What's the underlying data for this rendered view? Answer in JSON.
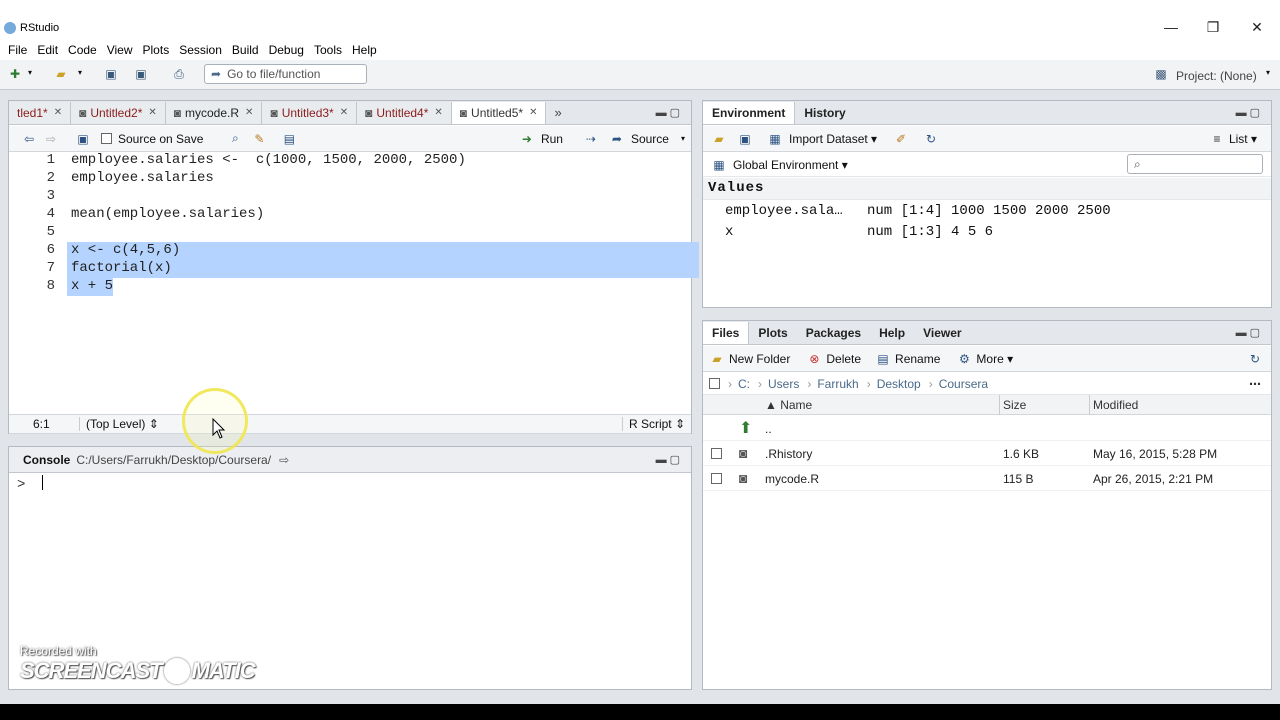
{
  "window": {
    "title": "RStudio",
    "controls": [
      "—",
      "❐",
      "✕"
    ]
  },
  "menu": [
    "File",
    "Edit",
    "Code",
    "View",
    "Plots",
    "Session",
    "Build",
    "Debug",
    "Tools",
    "Help"
  ],
  "toolbar": {
    "goto_placeholder": "Go to file/function",
    "project_label": "Project: (None)"
  },
  "source": {
    "tabs": [
      {
        "label": "tled1*",
        "active": false
      },
      {
        "label": "Untitled2*",
        "active": false
      },
      {
        "label": "mycode.R",
        "active": false
      },
      {
        "label": "Untitled3*",
        "active": false
      },
      {
        "label": "Untitled4*",
        "active": false
      },
      {
        "label": "Untitled5*",
        "active": true
      }
    ],
    "source_on_save": "Source on Save",
    "run_label": "Run",
    "source_label": "Source",
    "lines": [
      {
        "n": "1",
        "code": "employee.salaries <-  c(1000, 1500, 2000, 2500)",
        "selected": false
      },
      {
        "n": "2",
        "code": "employee.salaries",
        "selected": false
      },
      {
        "n": "3",
        "code": "",
        "selected": false
      },
      {
        "n": "4",
        "code": "mean(employee.salaries)",
        "selected": false
      },
      {
        "n": "5",
        "code": "",
        "selected": false
      },
      {
        "n": "6",
        "code": "x <- c(4,5,6)",
        "selected": true
      },
      {
        "n": "7",
        "code": "factorial(x)",
        "selected": true
      },
      {
        "n": "8",
        "code": "x + 5",
        "selected": true
      }
    ],
    "status": {
      "position": "6:1",
      "scope": "(Top Level) ⇕",
      "type": "R Script ⇕"
    }
  },
  "console": {
    "title": "Console",
    "path": "C:/Users/Farrukh/Desktop/Coursera/",
    "prompt": ">"
  },
  "environment": {
    "tabs": [
      "Environment",
      "History"
    ],
    "import_label": "Import Dataset ▾",
    "list_label": "List ▾",
    "scope_label": "Global Environment ▾",
    "section": "Values",
    "rows": [
      {
        "name": "employee.sala…",
        "value": "num [1:4] 1000 1500 2000 2500"
      },
      {
        "name": "x",
        "value": "num [1:3] 4 5 6"
      }
    ]
  },
  "files": {
    "tabs": [
      "Files",
      "Plots",
      "Packages",
      "Help",
      "Viewer"
    ],
    "actions": {
      "new_folder": "New Folder",
      "delete": "Delete",
      "rename": "Rename",
      "more": "More ▾"
    },
    "breadcrumb": [
      "C:",
      "Users",
      "Farrukh",
      "Desktop",
      "Coursera"
    ],
    "columns": {
      "name": "▲ Name",
      "size": "Size",
      "modified": "Modified"
    },
    "parent": "..",
    "rows": [
      {
        "name": ".Rhistory",
        "size": "1.6 KB",
        "modified": "May 16, 2015, 5:28 PM"
      },
      {
        "name": "mycode.R",
        "size": "115 B",
        "modified": "Apr 26, 2015, 2:21 PM"
      }
    ]
  },
  "watermark": {
    "line1": "Recorded with",
    "line2": "SCREENCAST",
    "line3": "MATIC"
  }
}
